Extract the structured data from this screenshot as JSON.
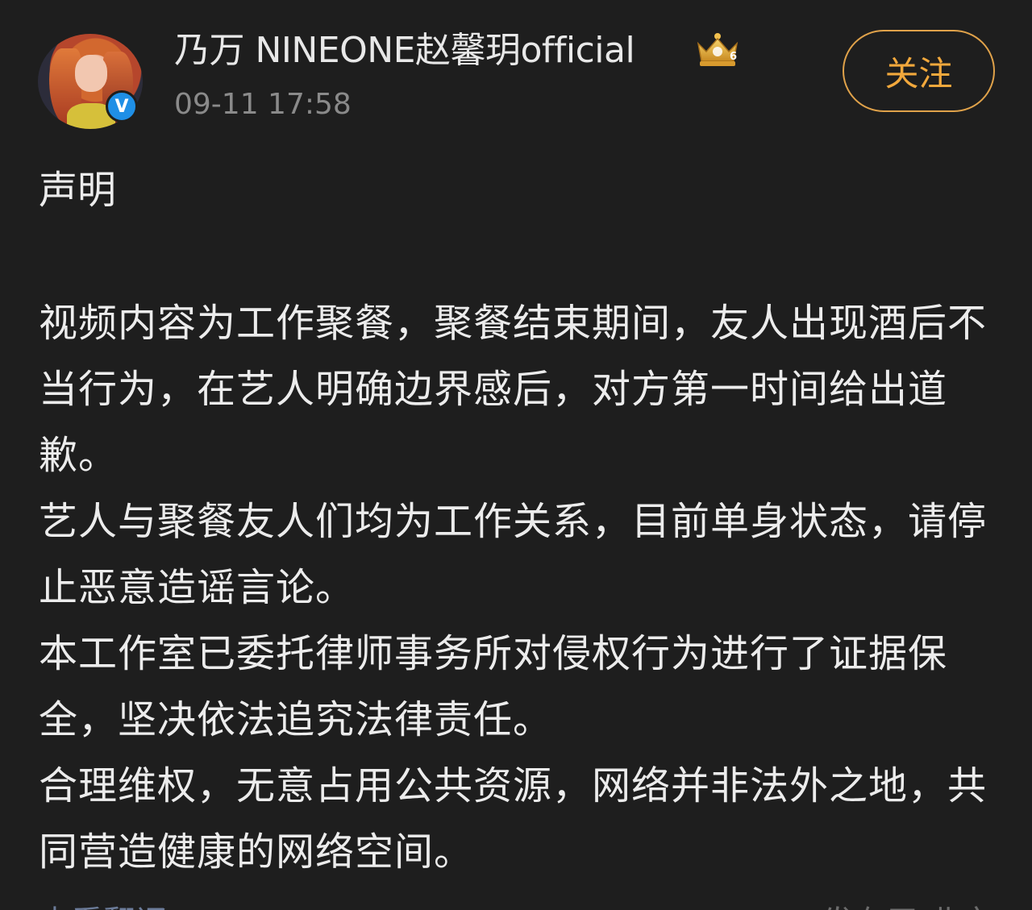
{
  "header": {
    "username": "乃万 NINEONE赵馨玥official",
    "timestamp": "09-11 17:58",
    "verified_badge_text": "V",
    "follow_label": "关注",
    "avatar_icon": "user-avatar",
    "crown_icon": "crown-level-icon",
    "crown_level": "6"
  },
  "post": {
    "title": "声明",
    "paragraphs": [
      "视频内容为工作聚餐，聚餐结束期间，友人出现酒后不当行为，在艺人明确边界感后，对方第一时间给出道歉。",
      "艺人与聚餐友人们均为工作关系，目前单身状态，请停止恶意造谣言论。",
      "本工作室已委托律师事务所对侵权行为进行了证据保全，坚决依法追究法律责任。",
      "合理维权，无意占用公共资源，网络并非法外之地，共同营造健康的网络空间。"
    ]
  },
  "footer": {
    "translate_label": "查看翻译",
    "location_label": "发布于 北京"
  },
  "colors": {
    "background": "#1e1e1e",
    "accent": "#f2a83c",
    "verified": "#1f8fe6",
    "muted": "#8a8a8a"
  }
}
